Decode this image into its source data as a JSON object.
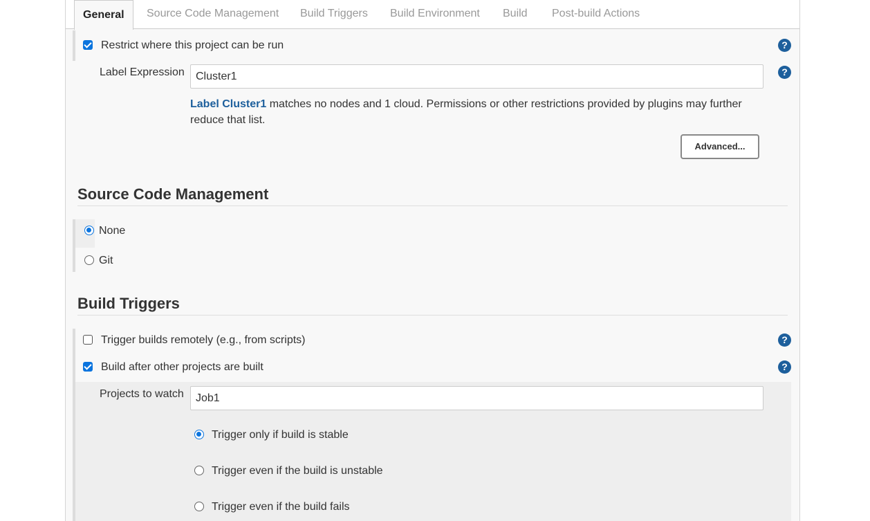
{
  "tabs": [
    {
      "label": "General",
      "active": true
    },
    {
      "label": "Source Code Management",
      "active": false
    },
    {
      "label": "Build Triggers",
      "active": false
    },
    {
      "label": "Build Environment",
      "active": false
    },
    {
      "label": "Build",
      "active": false
    },
    {
      "label": "Post-build Actions",
      "active": false
    }
  ],
  "general": {
    "restrict_label": "Restrict where this project can be run",
    "restrict_checked": true,
    "label_expression_label": "Label Expression",
    "label_expression_value": "Cluster1",
    "info_link": "Label Cluster1",
    "info_text": " matches no nodes and 1 cloud. Permissions or other restrictions provided by plugins may further reduce that list.",
    "advanced_button": "Advanced..."
  },
  "scm": {
    "title": "Source Code Management",
    "options": [
      {
        "label": "None",
        "selected": true
      },
      {
        "label": "Git",
        "selected": false
      }
    ]
  },
  "triggers": {
    "title": "Build Triggers",
    "remote_label": "Trigger builds remotely (e.g., from scripts)",
    "remote_checked": false,
    "after_label": "Build after other projects are built",
    "after_checked": true,
    "projects_label": "Projects to watch",
    "projects_value": "Job1",
    "options": [
      {
        "label": "Trigger only if build is stable",
        "selected": true
      },
      {
        "label": "Trigger even if the build is unstable",
        "selected": false
      },
      {
        "label": "Trigger even if the build fails",
        "selected": false
      }
    ]
  },
  "help_icon_text": "?",
  "colors": {
    "accent": "#0b74de",
    "help": "#1d5f9c",
    "link": "#1d5f9c"
  }
}
